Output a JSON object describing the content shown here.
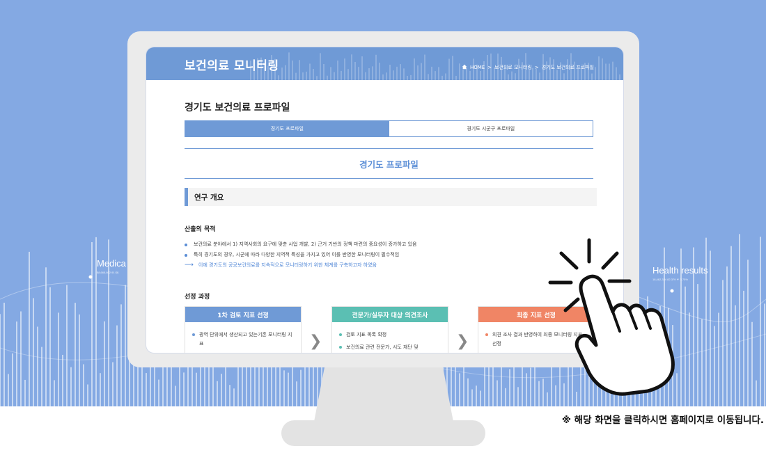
{
  "background": {
    "left_label": "Medica",
    "left_small": "$8,665,802.91  $8.",
    "right_label": "Health results",
    "right_small": "18,462,324   82.379  ▼ 3.75%",
    "accent": "#84a9e3"
  },
  "site": {
    "logo": "보건의료 모니터링",
    "breadcrumb": {
      "home": "HOME",
      "sep": ">",
      "level1": "보건의료 모니터링",
      "level2": "경기도 보건의료 프로파일"
    }
  },
  "page": {
    "title": "경기도 보건의료 프로파일",
    "tabs": [
      {
        "label": "경기도 프로파일",
        "active": true
      },
      {
        "label": "경기도 시군구 프로파일",
        "active": false
      }
    ],
    "section_title": "경기도 프로파일",
    "subheading": "연구 개요",
    "purpose": {
      "title": "산출의 목적",
      "bullets": [
        "보건의료 분야에서 1) 지역사회의 요구에 맞춘 사업 개발, 2) 근거 기반의 정책 마련의 중요성이 증가하고 있음",
        "특히 경기도의 경우, 시군에 따라 다양한 지역적 특성을 가지고 있어 이를 반영한 모니터링이 필수적임"
      ],
      "conclusion": "이에 경기도의 공공보건의료를 지속적으로 모니터링하기 위한 체계를 구축하고자 하였음"
    },
    "process": {
      "title": "선정 과정",
      "cards": [
        {
          "title": "1차 검토 지표 선정",
          "color": "#6f9ad6",
          "items": [
            "광역 단위에서 생산되고 있는기존 모니터링 지표"
          ]
        },
        {
          "title": "전문가/실무자 대상 의견조사",
          "color": "#5bbfb3",
          "items": [
            "검토 지표 목록 확정",
            "보건의료 관련 전문가, 시도 재단 및"
          ]
        },
        {
          "title": "최종 지표 선정",
          "color": "#f08565",
          "items": [
            "의견 조사 결과 반영하여 최종 모니터링 지표 선정"
          ]
        }
      ]
    }
  },
  "note": "※ 해당 화면을 클릭하시면 홈페이지로 이동됩니다."
}
